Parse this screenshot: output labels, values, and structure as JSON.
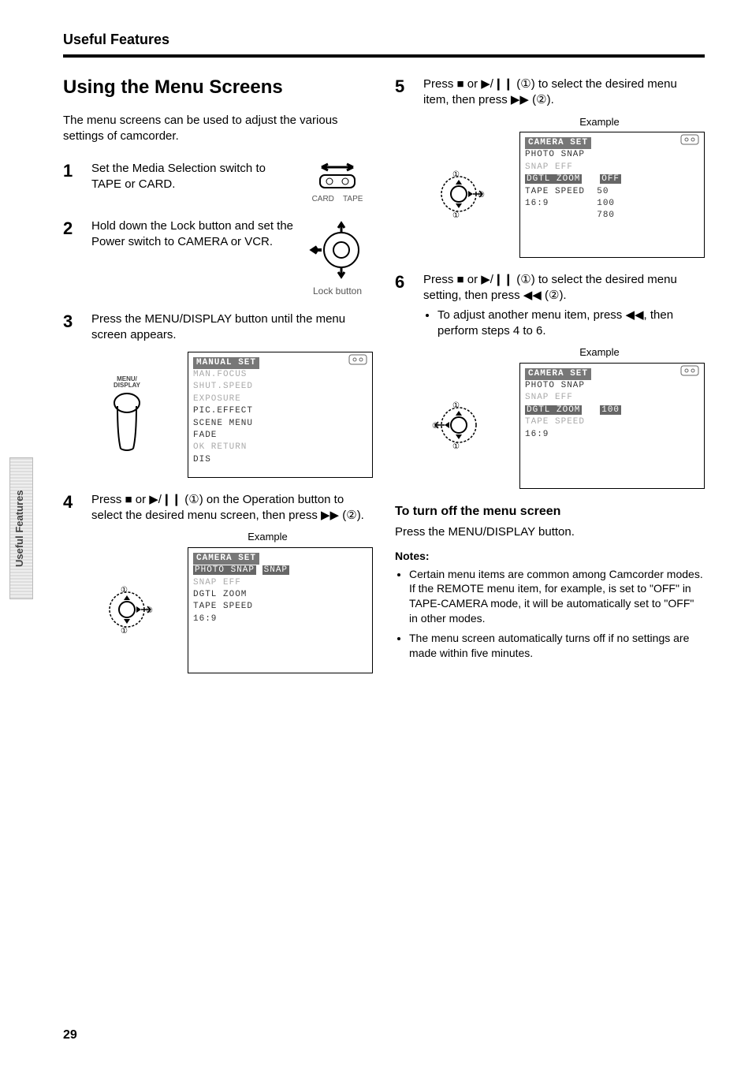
{
  "header": {
    "section": "Useful Features"
  },
  "title": "Using the Menu Screens",
  "intro": "The menu screens can be used to adjust the various settings of camcorder.",
  "steps": {
    "s1": "Set the Media Selection switch to TAPE or CARD.",
    "s1_card": "CARD",
    "s1_tape": "TAPE",
    "s2": "Hold down the Lock button and set the Power switch to CAMERA or VCR.",
    "s2_label": "Lock button",
    "s3": "Press the MENU/DISPLAY button until the menu screen appears.",
    "s3_btn": "MENU/\nDISPLAY",
    "s4_a": "Press ",
    "s4_b": " or ",
    "s4_c": " (①) on the Operation button to select the desired menu screen, then press ",
    "s4_d": " (②).",
    "s4_ex": "Example",
    "s5_a": "Press ",
    "s5_b": " or ",
    "s5_c": " (①) to select the desired menu item, then press ",
    "s5_d": " (②).",
    "s5_ex": "Example",
    "s6_a": "Press ",
    "s6_b": " or ",
    "s6_c": " (①) to select the desired menu setting, then press ",
    "s6_d": " (②).",
    "s6_bullet": "To adjust another menu item, press ◀◀, then perform steps 4 to 6.",
    "s6_ex": "Example"
  },
  "screens": {
    "manual": {
      "title": "MANUAL SET",
      "l1": "MAN.FOCUS",
      "l2": "SHUT.SPEED",
      "l3": "EXPOSURE",
      "l4": "PIC.EFFECT",
      "l5": "SCENE MENU",
      "l6": "FADE",
      "l7": "OK RETURN",
      "l8": "DIS"
    },
    "cam4": {
      "title": "CAMERA SET",
      "l1": "PHOTO SNAP",
      "l1v": "SNAP",
      "l2": "SNAP EFF",
      "l3": "DGTL ZOOM",
      "l4": "TAPE SPEED",
      "l5": "16:9"
    },
    "cam5": {
      "title": "CAMERA SET",
      "l1": "PHOTO SNAP",
      "l2": "SNAP EFF",
      "l3": "DGTL ZOOM",
      "l3v": "OFF",
      "l4": "TAPE SPEED",
      "v1": "50",
      "l5": "16:9",
      "v2": "100",
      "v3": "780"
    },
    "cam6": {
      "title": "CAMERA SET",
      "l1": "PHOTO SNAP",
      "l2": "SNAP EFF",
      "l3": "DGTL ZOOM",
      "l3v": "100",
      "l4": "TAPE SPEED",
      "l5": "16:9"
    }
  },
  "turnoff": {
    "head": "To turn off the menu screen",
    "body": "Press the MENU/DISPLAY button."
  },
  "notes": {
    "head": "Notes:",
    "n1": "Certain menu items are common among Camcorder modes. If the REMOTE menu item, for example, is set to \"OFF\" in TAPE-CAMERA mode, it will be automatically set to \"OFF\" in other modes.",
    "n2": "The menu screen automatically turns off if no settings are made within five minutes."
  },
  "side_tab": "Useful Features",
  "page": "29",
  "icons": {
    "stop": "■",
    "playpause": "▶/❙❙",
    "ff": "▶▶",
    "rew": "◀◀"
  }
}
